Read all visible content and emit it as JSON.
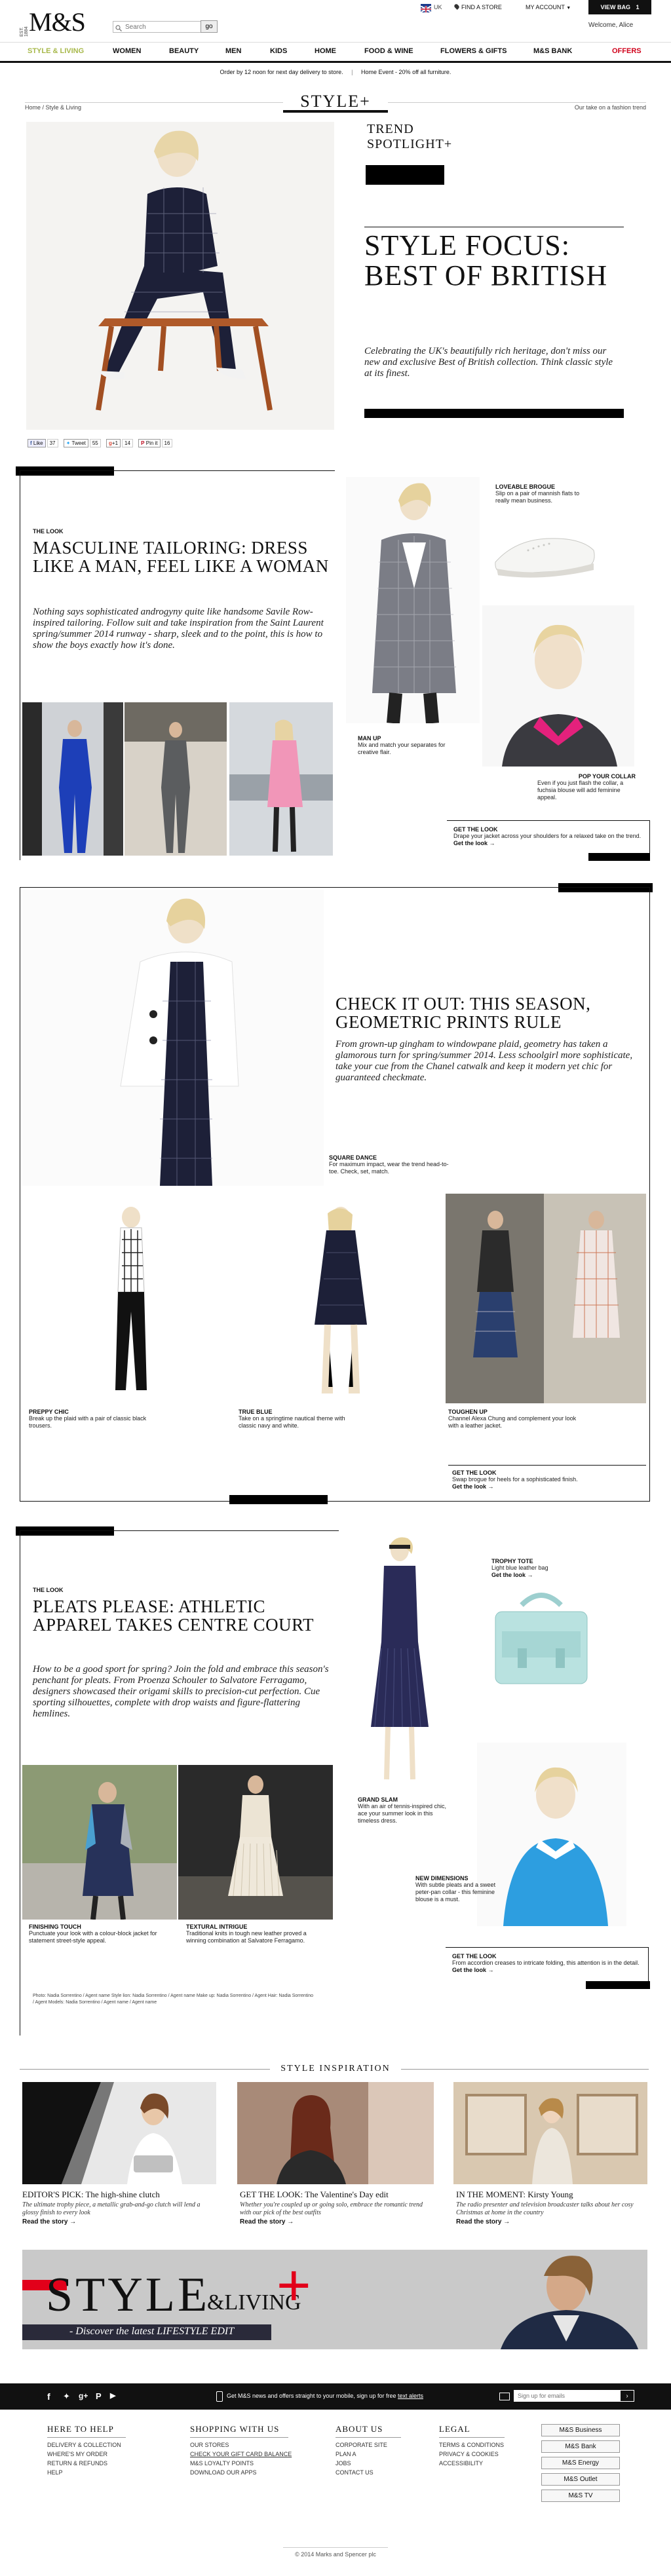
{
  "header": {
    "logo": "M&S",
    "logo_small": "EST. 1884",
    "search_placeholder": "Search",
    "go_label": "go",
    "flag_label": "UK",
    "find_store": "FIND A STORE",
    "my_account": "MY ACCOUNT",
    "view_bag": "VIEW BAG",
    "bag_count": "1",
    "welcome": "Welcome, Alice"
  },
  "nav": {
    "items": [
      "STYLE & LIVING",
      "WOMEN",
      "BEAUTY",
      "MEN",
      "KIDS",
      "HOME",
      "FOOD & WINE",
      "FLOWERS & GIFTS",
      "M&S BANK",
      "OFFERS"
    ]
  },
  "promo": {
    "left": "Order by 12 noon for next day delivery to store.",
    "right": "Home Event - 20% off all furniture."
  },
  "breadcrumb": {
    "home": "Home",
    "current": "Style & Living",
    "right": "Our take on a fashion trend"
  },
  "style_logo": "STYLE+",
  "hero": {
    "trend": "TREND",
    "spotlight": "SPOTLIGHT+",
    "title": "STYLE FOCUS: BEST OF BRITISH",
    "intro": "Celebrating the UK's beautifully rich heritage, don't miss our new and exclusive Best of British collection. Think classic style at its finest."
  },
  "social": {
    "like": "Like",
    "like_count": "37",
    "tweet": "Tweet",
    "tweet_count": "55",
    "gplus": "+1",
    "gplus_count": "14",
    "pin": "Pin it",
    "pin_count": "16"
  },
  "look1": {
    "kicker": "THE LOOK",
    "title": "MASCULINE TAILORING: DRESS LIKE A MAN, FEEL LIKE A WOMAN",
    "text": "Nothing says sophisticated androgyny quite like handsome Savile Row-inspired tailoring. Follow suit and take inspiration from the Saint Laurent spring/summer 2014 runway - sharp, sleek and to the point, this is how to show the boys exactly how it's done.",
    "cap1_title": "LOVEABLE BROGUE",
    "cap1_text": "Slip on a pair of mannish flats to really mean business.",
    "cap2_title": "MAN UP",
    "cap2_text": "Mix and match your separates for creative flair.",
    "cap3_title": "POP YOUR COLLAR",
    "cap3_text": "Even if you just flash the collar, a fuchsia blouse will add feminine appeal.",
    "get_title": "GET THE LOOK",
    "get_text": "Drape your jacket across your shoulders for a relaxed take on the trend.",
    "get_link": "Get the look →"
  },
  "look2": {
    "title": "CHECK IT OUT: THIS SEASON, GEOMETRIC PRINTS RULE",
    "text": "From grown-up gingham to windowpane plaid, geometry has taken a glamorous turn for spring/summer 2014. Less schoolgirl more sophisticate, take your cue from the Chanel catwalk and keep it modern yet chic for guaranteed checkmate.",
    "cap1_title": "SQUARE DANCE",
    "cap1_text": "For maximum impact, wear the trend head-to-toe. Check, set, match.",
    "cap2_title": "PREPPY CHIC",
    "cap2_text": "Break up the plaid with a pair of classic black trousers.",
    "cap3_title": "TRUE BLUE",
    "cap3_text": "Take on a springtime nautical theme with classic navy and white.",
    "cap4_title": "TOUGHEN UP",
    "cap4_text": "Channel Alexa Chung and complement your look with a leather jacket.",
    "get_title": "GET THE LOOK",
    "get_text": "Swap brogue for heels for a sophisticated finish.",
    "get_link": "Get the look →"
  },
  "look3": {
    "kicker": "THE LOOK",
    "title": "PLEATS PLEASE: ATHLETIC APPAREL TAKES CENTRE COURT",
    "text": "How to be a good sport for spring? Join the fold and embrace this season's penchant for pleats. From Proenza Schouler to Salvatore Ferragamo, designers showcased their origami skills to precision-cut perfection. Cue sporting silhouettes, complete with drop waists and figure-flattering hemlines.",
    "cap1_title": "TROPHY TOTE",
    "cap1_text": "Light blue leather bag",
    "cap1_link": "Get the look →",
    "cap2_title": "GRAND SLAM",
    "cap2_text": "With an air of tennis-inspired chic, ace your summer look in this timeless dress.",
    "cap3_title": "NEW DIMENSIONS",
    "cap3_text": "With subtle pleats and a sweet peter-pan collar - this feminine blouse is a must.",
    "cap4_title": "FINISHING TOUCH",
    "cap4_text": "Punctuate your look with a colour-block jacket for statement street-style appeal.",
    "cap5_title": "TEXTURAL INTRIGUE",
    "cap5_text": "Traditional knits in tough new leather proved a winning combination at Salvatore Ferragamo.",
    "get_title": "GET THE LOOK",
    "get_text": "From accordion creases to intricate folding, this attention is in the detail.",
    "get_link": "Get the look →",
    "credits": "Photo: Nadia Sorrentino / Agent name Style lion: Nadia Sorrentino / Agent name Make up: Nadia Sorrentino / Agent Hair: Nadia Sorrentino / Agent Models: Nadia Sorrentino / Agent name / Agent name"
  },
  "inspiration": {
    "heading": "STYLE INSPIRATION",
    "items": [
      {
        "title": "EDITOR'S PICK: The high-shine clutch",
        "text": "The ultimate trophy piece, a metallic grab-and-go clutch will lend a glossy finish to every look",
        "link": "Read the story →"
      },
      {
        "title": "GET THE LOOK: The Valentine's Day edit",
        "text": "Whether you're coupled up or going solo, embrace the romantic trend with our pick of the best outfits",
        "link": "Read the story →"
      },
      {
        "title": "IN THE MOMENT: Kirsty Young",
        "text": "The radio presenter and television broadcaster talks about her cosy Christmas at home in the country",
        "link": "Read the story →"
      }
    ]
  },
  "banner": {
    "title": "STYLE",
    "amp": "&LIVING",
    "plus": "+",
    "tagline": "- Discover the latest LIFESTYLE EDIT"
  },
  "footer": {
    "newsletter": "Get M&S news and offers straight to your mobile, sign up for free",
    "newsletter_link": "text alerts",
    "signup_placeholder": "Sign up for emails",
    "columns": [
      {
        "head": "HERE TO HELP",
        "links": [
          "DELIVERY & COLLECTION",
          "WHERE'S MY ORDER",
          "RETURN & REFUNDS",
          "HELP"
        ]
      },
      {
        "head": "SHOPPING WITH US",
        "links": [
          "OUR STORES",
          "CHECK YOUR GIFT CARD BALANCE",
          "M&S LOYALTY POINTS",
          "DOWNLOAD OUR APPS"
        ]
      },
      {
        "head": "ABOUT US",
        "links": [
          "CORPORATE SITE",
          "PLAN A",
          "JOBS",
          "CONTACT US"
        ]
      },
      {
        "head": "LEGAL",
        "links": [
          "TERMS & CONDITIONS",
          "PRIVACY & COOKIES",
          "ACCESSIBILITY"
        ]
      }
    ],
    "brands": [
      "M&S Business",
      "M&S Bank",
      "M&S Energy",
      "M&S Outlet",
      "M&S TV"
    ],
    "copyright": "© 2014 Marks and Spencer plc"
  }
}
